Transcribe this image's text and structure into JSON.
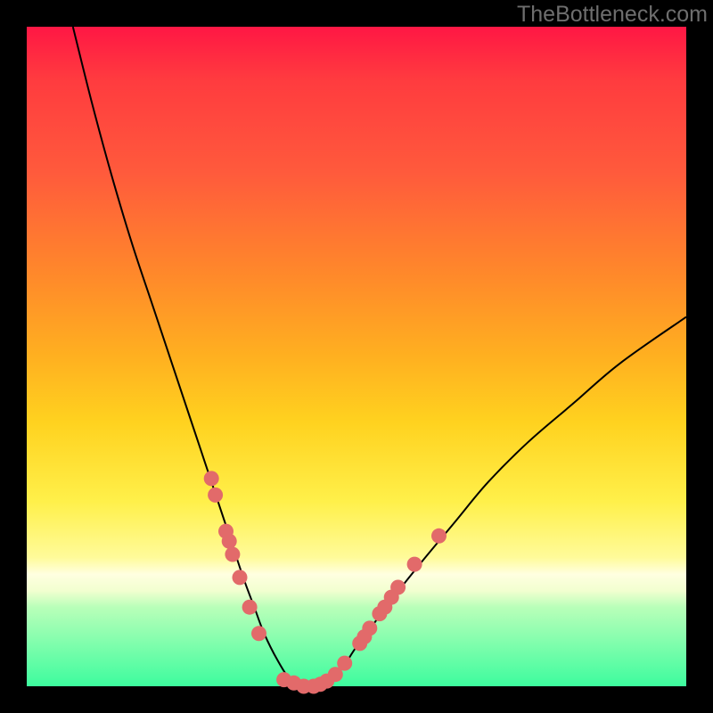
{
  "watermark": "TheBottleneck.com",
  "colors": {
    "curve_stroke": "#000000",
    "marker_fill": "#e26a6a",
    "marker_stroke": "#e26a6a"
  },
  "chart_data": {
    "type": "line",
    "title": "",
    "xlabel": "",
    "ylabel": "",
    "xlim": [
      0,
      100
    ],
    "ylim": [
      0,
      100
    ],
    "grid": false,
    "legend": false,
    "series": [
      {
        "name": "bottleneck-curve",
        "x": [
          7,
          10,
          13,
          16,
          19,
          22,
          25,
          27,
          29,
          31,
          33,
          34.5,
          36,
          38,
          40,
          42,
          44,
          46,
          48,
          50,
          53,
          56,
          60,
          65,
          70,
          76,
          83,
          90,
          100
        ],
        "y": [
          100,
          88,
          77,
          67,
          58,
          49,
          40,
          34,
          28,
          22,
          16,
          12,
          8,
          4,
          1,
          0,
          0,
          1,
          3,
          6,
          10,
          14,
          19,
          25,
          31,
          37,
          43,
          49,
          56
        ]
      }
    ],
    "markers": [
      {
        "x": 28.0,
        "y": 31.5
      },
      {
        "x": 28.6,
        "y": 29.0
      },
      {
        "x": 30.2,
        "y": 23.5
      },
      {
        "x": 30.7,
        "y": 22.0
      },
      {
        "x": 31.2,
        "y": 20.0
      },
      {
        "x": 32.3,
        "y": 16.5
      },
      {
        "x": 33.8,
        "y": 12.0
      },
      {
        "x": 35.2,
        "y": 8.0
      },
      {
        "x": 39.0,
        "y": 1.0
      },
      {
        "x": 40.5,
        "y": 0.5
      },
      {
        "x": 42.0,
        "y": 0.0
      },
      {
        "x": 43.5,
        "y": 0.0
      },
      {
        "x": 44.5,
        "y": 0.3
      },
      {
        "x": 45.5,
        "y": 0.8
      },
      {
        "x": 46.8,
        "y": 1.8
      },
      {
        "x": 48.2,
        "y": 3.5
      },
      {
        "x": 50.5,
        "y": 6.5
      },
      {
        "x": 51.2,
        "y": 7.5
      },
      {
        "x": 52.0,
        "y": 8.8
      },
      {
        "x": 53.5,
        "y": 11.0
      },
      {
        "x": 54.3,
        "y": 12.0
      },
      {
        "x": 55.3,
        "y": 13.5
      },
      {
        "x": 56.3,
        "y": 15.0
      },
      {
        "x": 58.8,
        "y": 18.5
      },
      {
        "x": 62.5,
        "y": 22.8
      }
    ]
  }
}
